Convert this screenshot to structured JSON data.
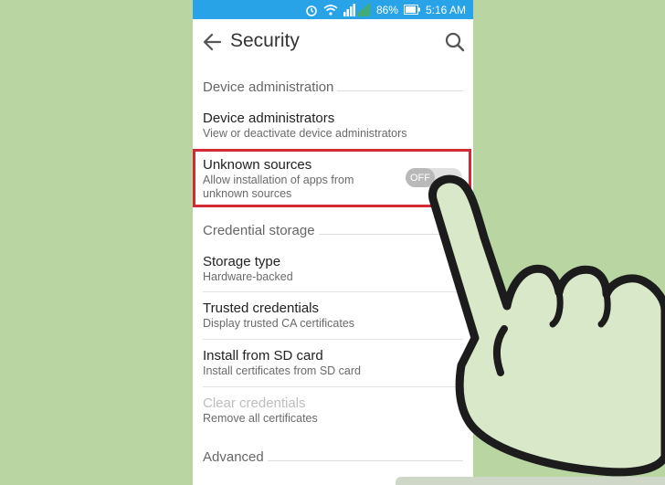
{
  "statusbar": {
    "battery": "86%",
    "time": "5:16 AM"
  },
  "appbar": {
    "title": "Security",
    "back_icon": "arrow-left-icon",
    "search_icon": "search-icon"
  },
  "sections": {
    "device_admin": "Device administration",
    "credential_storage": "Credential storage",
    "advanced": "Advanced"
  },
  "items": {
    "device_admins": {
      "title": "Device administrators",
      "subtitle": "View or deactivate device administrators"
    },
    "unknown_sources": {
      "title": "Unknown sources",
      "subtitle_line1": "Allow installation of apps from",
      "subtitle_line2": "unknown sources",
      "toggle": "OFF"
    },
    "storage_type": {
      "title": "Storage type",
      "subtitle": "Hardware-backed"
    },
    "trusted_credentials": {
      "title": "Trusted credentials",
      "subtitle": "Display trusted CA certificates"
    },
    "install_sd": {
      "title": "Install from SD card",
      "subtitle": "Install certificates from SD card"
    },
    "clear_credentials": {
      "title": "Clear credentials",
      "subtitle": "Remove all certificates"
    }
  },
  "colors": {
    "statusbar": "#28a3e8",
    "highlight": "#d42a35",
    "background": "#b9d5a2"
  }
}
